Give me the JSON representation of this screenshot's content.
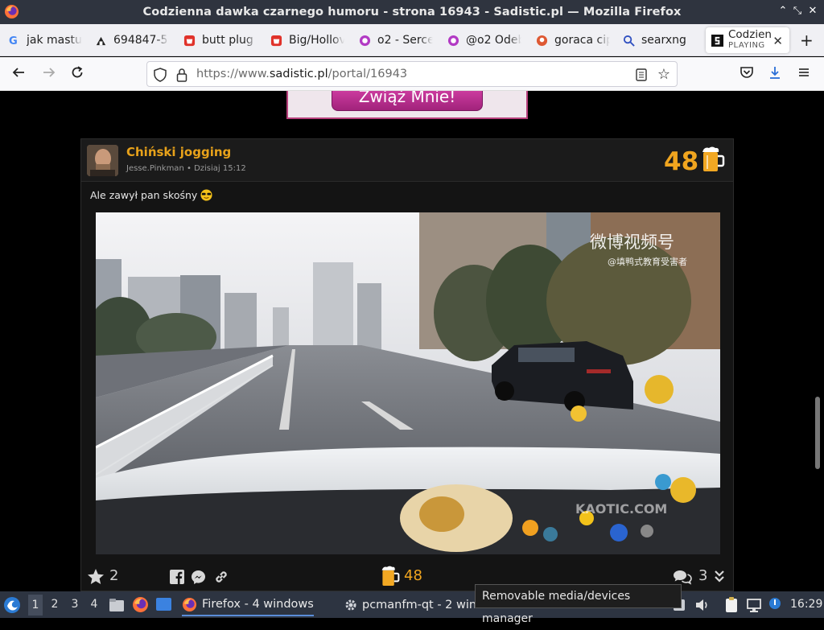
{
  "window": {
    "title": "Codzienna dawka czarnego humoru - strona 16943 - Sadistic.pl — Mozilla Firefox",
    "controls": [
      "⌃",
      "⌄",
      "✕"
    ]
  },
  "tabs": [
    {
      "label": "jak mastu",
      "icon": "google-icon"
    },
    {
      "label": "694847-5",
      "icon": "generic-site-icon"
    },
    {
      "label": "butt plug",
      "icon": "shopping-icon"
    },
    {
      "label": "Big/Hollov",
      "icon": "shopping-icon"
    },
    {
      "label": "o2 - Serce",
      "icon": "o2-icon"
    },
    {
      "label": "@o2 Odeb",
      "icon": "o2-icon"
    },
    {
      "label": "goraca cip",
      "icon": "duckduckgo-icon"
    },
    {
      "label": "searxng",
      "icon": "search-icon"
    }
  ],
  "active_tab": {
    "label": "Codzien",
    "sublabel": "PLAYING"
  },
  "nav": {
    "url_prefix": "https://www.",
    "url_domain": "sadistic.pl",
    "url_path": "/portal/16943"
  },
  "ad": {
    "button_label": "Zwiąż Mnie!"
  },
  "post": {
    "title": "Chiński jogging",
    "author": "Jesse.Pinkman",
    "separator": "•",
    "date": "Dzisiaj 15:12",
    "score": "48",
    "caption": "Ale zawył pan skośny",
    "video_watermark_top": "微博视频号",
    "video_watermark_sub": "@填鸭式教育受害者",
    "video_watermark_bottom": "KAOTIC.COM",
    "favorites_count": "2",
    "beer_count": "48",
    "comments_count": "3"
  },
  "taskbar": {
    "desktops": [
      "1",
      "2",
      "3",
      "4"
    ],
    "tasks": [
      {
        "label": "Firefox - 4 windows"
      },
      {
        "label": "pcmanfm-qt - 2 windo..."
      }
    ],
    "tooltip": "Removable media/devices manager",
    "clock": "16:29"
  },
  "colors": {
    "accent": "#e8a21a",
    "score": "#f0a51f",
    "titlebar": "#2f343f",
    "taskbar": "#2d3441"
  }
}
